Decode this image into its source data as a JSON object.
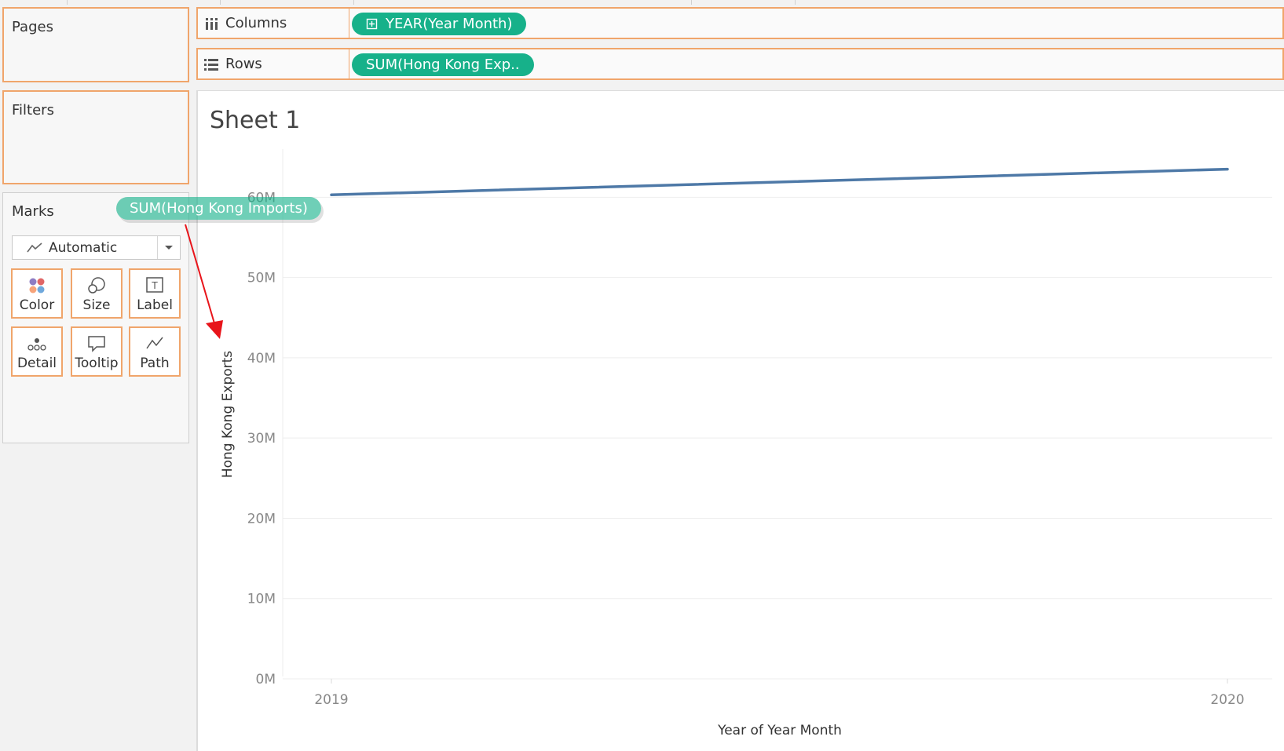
{
  "cards": {
    "pages": {
      "title": "Pages"
    },
    "filters": {
      "title": "Filters"
    },
    "marks": {
      "title": "Marks",
      "mark_type": "Automatic",
      "buttons": [
        {
          "label": "Color",
          "icon": "color-icon"
        },
        {
          "label": "Size",
          "icon": "size-icon"
        },
        {
          "label": "Label",
          "icon": "label-icon"
        },
        {
          "label": "Detail",
          "icon": "detail-icon"
        },
        {
          "label": "Tooltip",
          "icon": "tooltip-icon"
        },
        {
          "label": "Path",
          "icon": "path-icon"
        }
      ]
    }
  },
  "shelves": {
    "columns": {
      "label": "Columns",
      "pill": "YEAR(Year Month)"
    },
    "rows": {
      "label": "Rows",
      "pill": "SUM(Hong Kong Exp.."
    }
  },
  "drag_pill": "SUM(Hong Kong Imports)",
  "sheet": {
    "title": "Sheet 1"
  },
  "colors": {
    "pill_green": "#17b18a",
    "line": "#4e79a7",
    "highlight_border": "#f0a56b",
    "arrow": "#e8141a"
  },
  "chart_data": {
    "type": "line",
    "x": [
      "2019",
      "2020"
    ],
    "series": [
      {
        "values": [
          60300000,
          63500000
        ]
      }
    ],
    "xlabel": "Year of Year Month",
    "ylabel": "Hong Kong Exports",
    "yticks": [
      "0M",
      "10M",
      "20M",
      "30M",
      "40M",
      "50M",
      "60M"
    ],
    "ylim": [
      0,
      66000000
    ],
    "grid": true
  }
}
